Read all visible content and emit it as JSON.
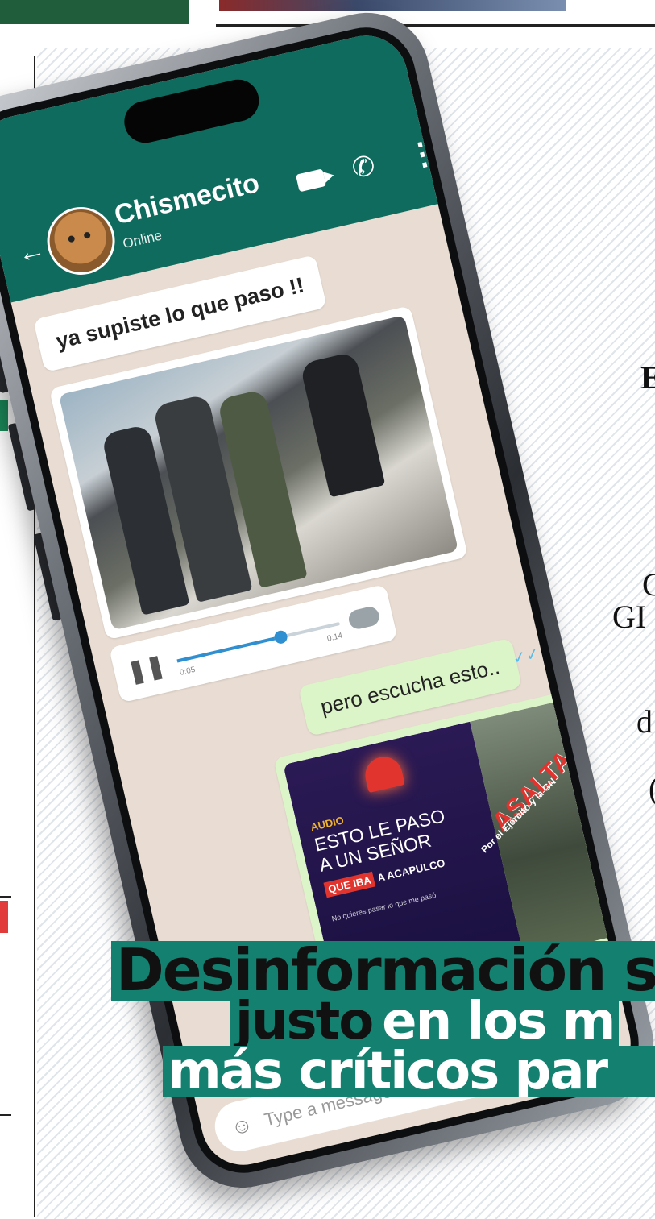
{
  "chat": {
    "contact_name": "Chismecito",
    "status": "Online",
    "messages": {
      "incoming_text": "ya supiste lo que paso !!",
      "outgoing_text": "pero escucha esto..",
      "audio": {
        "elapsed": "0:05",
        "duration": "0:14",
        "progress": 0.6
      }
    },
    "promo": {
      "tag": "AUDIO",
      "headline_line1": "ESTO LE PASO",
      "headline_line2": "A UN SEÑOR",
      "highlight": "QUE IBA",
      "destination": "A ACAPULCO",
      "footer": "No quieres pasar lo que me pasó",
      "stamp": "ASALTADO",
      "stamp_sub": "Por el Ejército y la GN"
    },
    "input_placeholder": "Type a message"
  },
  "headline": {
    "line1": "Desinformación se",
    "line2_dark": "justo",
    "line2_light": "en los m",
    "line3": "más críticos par"
  },
  "edge_text": [
    "E",
    "C",
    "GI",
    "d",
    "("
  ]
}
